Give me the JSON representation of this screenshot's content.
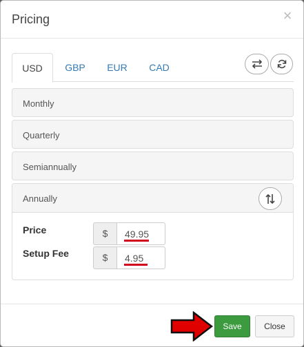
{
  "modal": {
    "title": "Pricing",
    "close_glyph": "×"
  },
  "tabs": [
    "USD",
    "GBP",
    "EUR",
    "CAD"
  ],
  "active_tab": "USD",
  "toolbar_icons": [
    "swap-icon",
    "refresh-icon"
  ],
  "panels": {
    "monthly": "Monthly",
    "quarterly": "Quarterly",
    "semiannually": "Semiannually",
    "annually": "Annually"
  },
  "annually": {
    "price": {
      "label": "Price",
      "currency_symbol": "$",
      "value": "49.95"
    },
    "setup_fee": {
      "label": "Setup Fee",
      "currency_symbol": "$",
      "value": "4.95"
    }
  },
  "footer": {
    "save_label": "Save",
    "close_label": "Close"
  },
  "colors": {
    "save_green": "#3c9a3f",
    "highlight_red": "#d0021b",
    "link_blue": "#337ab7",
    "annotation_arrow": "#e00000"
  }
}
